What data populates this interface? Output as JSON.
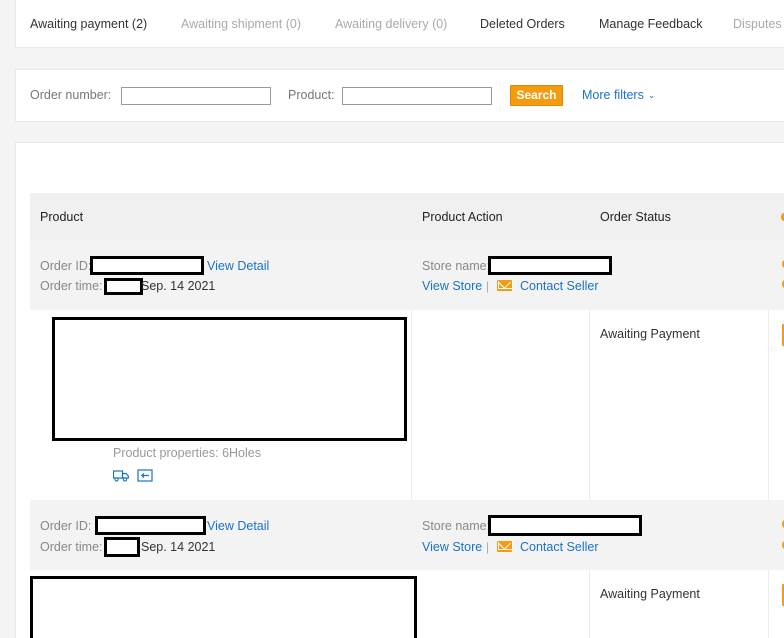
{
  "tabs": [
    {
      "label": "Awaiting payment",
      "count": "(2)",
      "state": "active"
    },
    {
      "label": "Awaiting shipment",
      "count": "(0)",
      "state": "muted"
    },
    {
      "label": "Awaiting delivery",
      "count": "(0)",
      "state": "muted"
    },
    {
      "label": "Deleted Orders",
      "count": "",
      "state": "normal"
    },
    {
      "label": "Manage Feedback",
      "count": "",
      "state": "normal"
    },
    {
      "label": "Disputes",
      "count": "",
      "state": "muted"
    }
  ],
  "filters": {
    "order_number_label": "Order number:",
    "order_number_value": "",
    "product_label": "Product:",
    "product_value": "",
    "search_label": "Search",
    "more_filters_label": "More filters"
  },
  "table": {
    "headers": [
      "Product",
      "Product Action",
      "Order Status"
    ]
  },
  "orders": [
    {
      "order_id_label": "Order ID:",
      "view_detail": "View Detail",
      "order_time_label": "Order time:",
      "order_time_value": "Sep. 14 2021",
      "store_name_label": "Store name:",
      "view_store": "View Store",
      "separator": "|",
      "contact_seller": "Contact Seller",
      "status": "Awaiting Payment",
      "product_properties": "Product properties: 6Holes"
    },
    {
      "order_id_label": "Order ID:",
      "view_detail": "View Detail",
      "order_time_label": "Order time:",
      "order_time_value": "Sep. 14 2021",
      "store_name_label": "Store name:",
      "view_store": "View Store",
      "separator": "|",
      "contact_seller": "Contact Seller",
      "status": "Awaiting Payment"
    }
  ],
  "colors": {
    "accent": "#f39c12",
    "link": "#1a73c7"
  }
}
